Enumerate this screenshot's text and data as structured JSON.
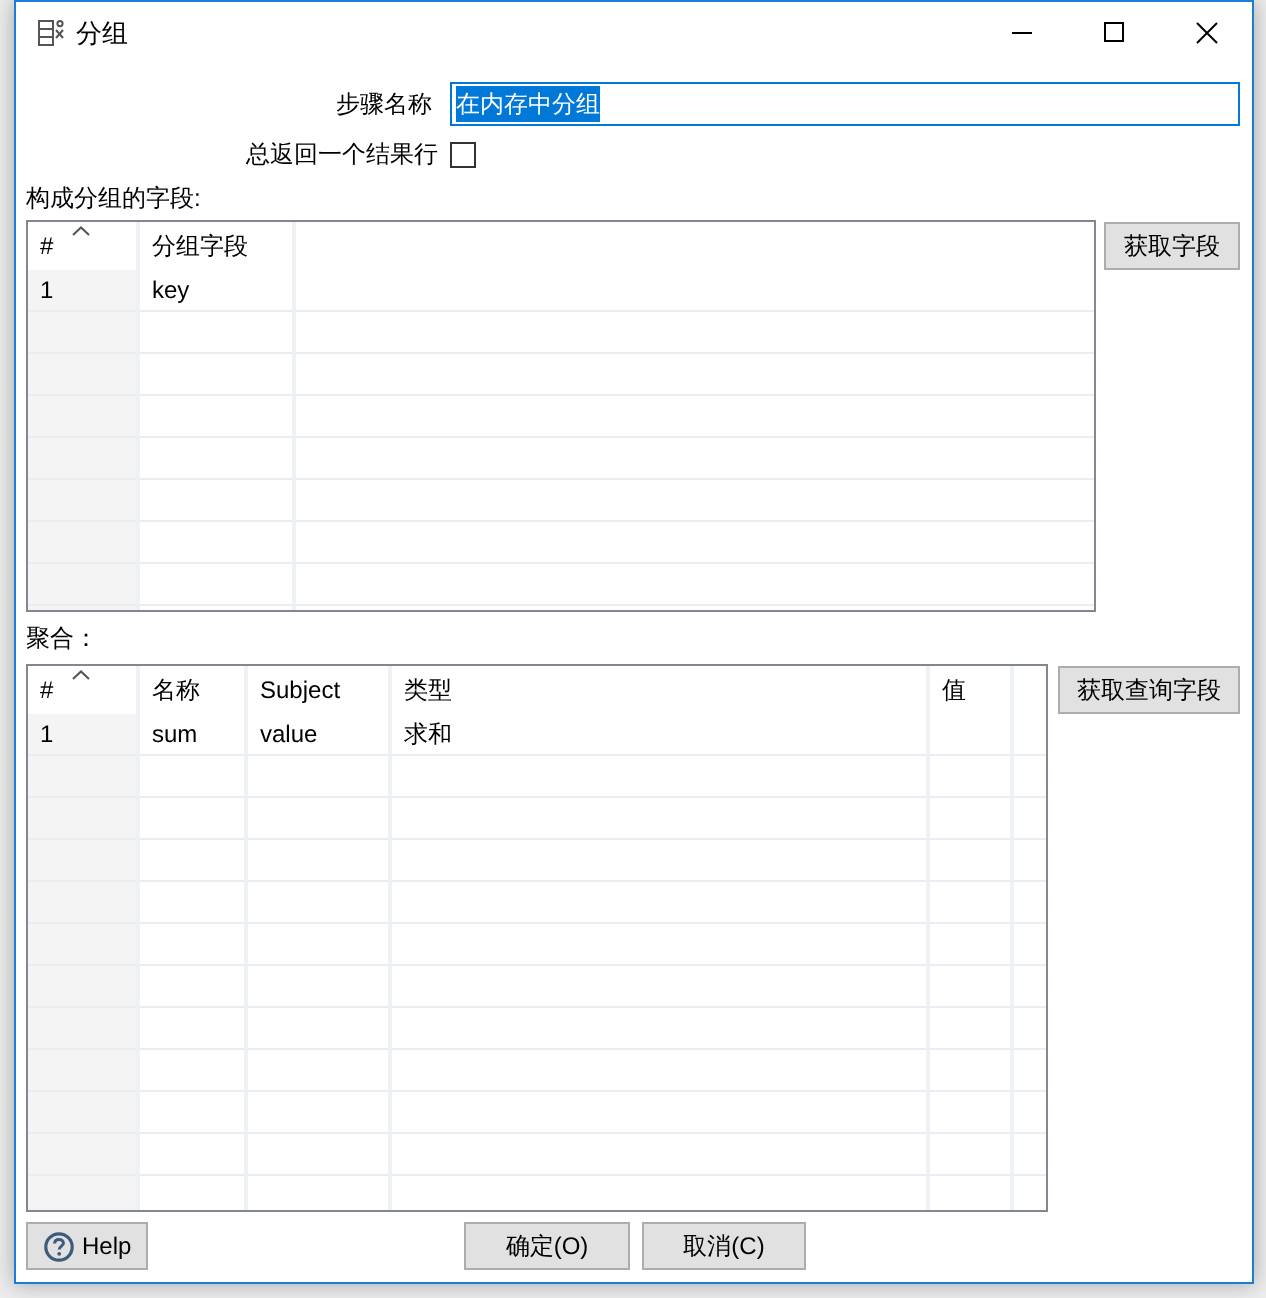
{
  "window": {
    "title": "分组"
  },
  "step_name": {
    "label": "步骤名称",
    "value": "在内存中分组",
    "text_selected": true
  },
  "single_result_row": {
    "label": "总返回一个结果行",
    "checked": false
  },
  "group_fields": {
    "label": "构成分组的字段:",
    "columns": [
      {
        "label": "#",
        "sorted": true
      },
      {
        "label": "分组字段",
        "sorted": false
      }
    ],
    "rows": [
      [
        "1",
        "key"
      ]
    ],
    "button": "获取字段"
  },
  "aggregates": {
    "label": "聚合：",
    "columns": [
      {
        "label": "#",
        "sorted": true
      },
      {
        "label": "名称",
        "sorted": false
      },
      {
        "label": "Subject",
        "sorted": false
      },
      {
        "label": "类型",
        "sorted": false
      },
      {
        "label": "值",
        "sorted": false
      }
    ],
    "rows": [
      [
        "1",
        "sum",
        "value",
        "求和"
      ]
    ],
    "button": "获取查询字段"
  },
  "buttons": [
    {
      "kind": "help",
      "label": "Help"
    },
    {
      "kind": "ok",
      "label": "确定(O)"
    },
    {
      "kind": "cancel",
      "label": "取消(C)"
    }
  ]
}
